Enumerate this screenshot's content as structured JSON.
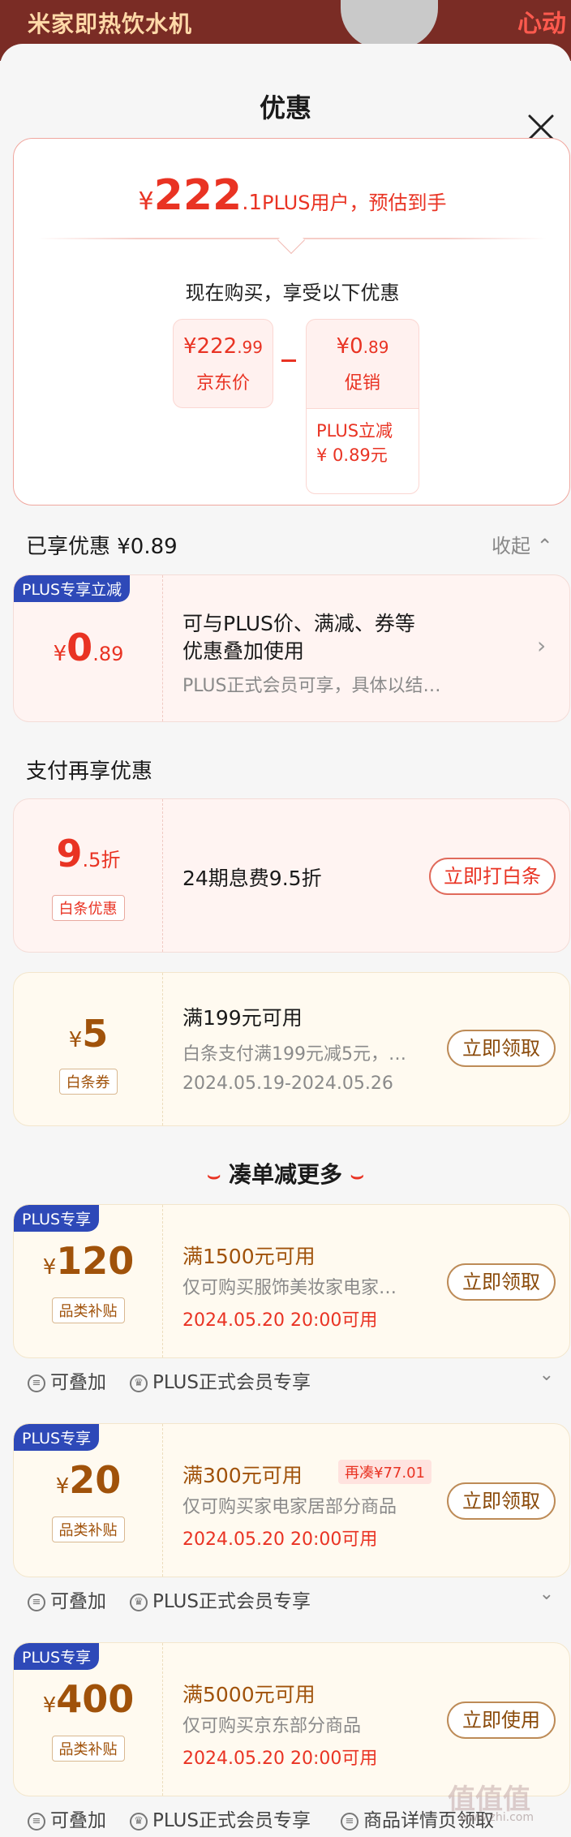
{
  "banner": {
    "left_text": "米家即热饮水机",
    "right_text": "心动"
  },
  "sheet": {
    "title": "优惠"
  },
  "summary": {
    "currency": "¥",
    "price_int": "222",
    "price_dec": ".1",
    "desc": "PLUS用户，预估到手",
    "sub": "现在购买，享受以下优惠",
    "jd_price": {
      "cur": "¥",
      "int": "222",
      "dec": ".99",
      "label": "京东价"
    },
    "promo": {
      "cur": "¥",
      "int": "0",
      "dec": ".89",
      "label": "促销",
      "detail1": "PLUS立减",
      "detail2": "¥ 0.89元"
    }
  },
  "enjoyed": {
    "label": "已享优惠 ¥0.89",
    "collapse": "收起"
  },
  "plus_card": {
    "tag": "PLUS专享立减",
    "cur": "¥",
    "int": "0",
    "dec": ".89",
    "line1": "可与PLUS价、满减、券等",
    "line1b": "优惠叠加使用",
    "line2": "PLUS正式会员可享，具体以结…"
  },
  "pay_label": "支付再享优惠",
  "baitiao_discount": {
    "int": "9",
    "dec": ".5",
    "unit": "折",
    "badge": "白条优惠",
    "text": "24期息费9.5折",
    "button": "立即打白条"
  },
  "baitiao_coupon": {
    "cur": "¥",
    "int": "5",
    "badge": "白条券",
    "line1": "满199元可用",
    "line2": "白条支付满199元减5元，…",
    "line3": "2024.05.19-2024.05.26",
    "button": "立即领取"
  },
  "more": {
    "title": "凑单减更多"
  },
  "coupons": [
    {
      "tag": "PLUS专享",
      "cur": "¥",
      "int": "120",
      "badge": "品类补贴",
      "line1": "满1500元可用",
      "line2": "仅可购买服饰美妆家电家…",
      "line3": "2024.05.20 20:00可用",
      "button": "立即领取",
      "foot1": "可叠加",
      "foot2": "PLUS正式会员专享"
    },
    {
      "tag": "PLUS专享",
      "cur": "¥",
      "int": "20",
      "badge": "品类补贴",
      "line1": "满300元可用",
      "extra": "再凑¥77.01",
      "line2": "仅可购买家电家居部分商品",
      "line3": "2024.05.20 20:00可用",
      "button": "立即领取",
      "foot1": "可叠加",
      "foot2": "PLUS正式会员专享"
    },
    {
      "tag": "PLUS专享",
      "cur": "¥",
      "int": "400",
      "badge": "品类补贴",
      "line1": "满5000元可用",
      "line2": "仅可购买京东部分商品",
      "line3": "2024.05.20 20:00可用",
      "button": "立即使用",
      "foot1": "可叠加",
      "foot2": "PLUS正式会员专享",
      "foot3": "商品详情页领取"
    }
  ],
  "watermark": "值值值",
  "watermark_url": "www.zhi.com"
}
